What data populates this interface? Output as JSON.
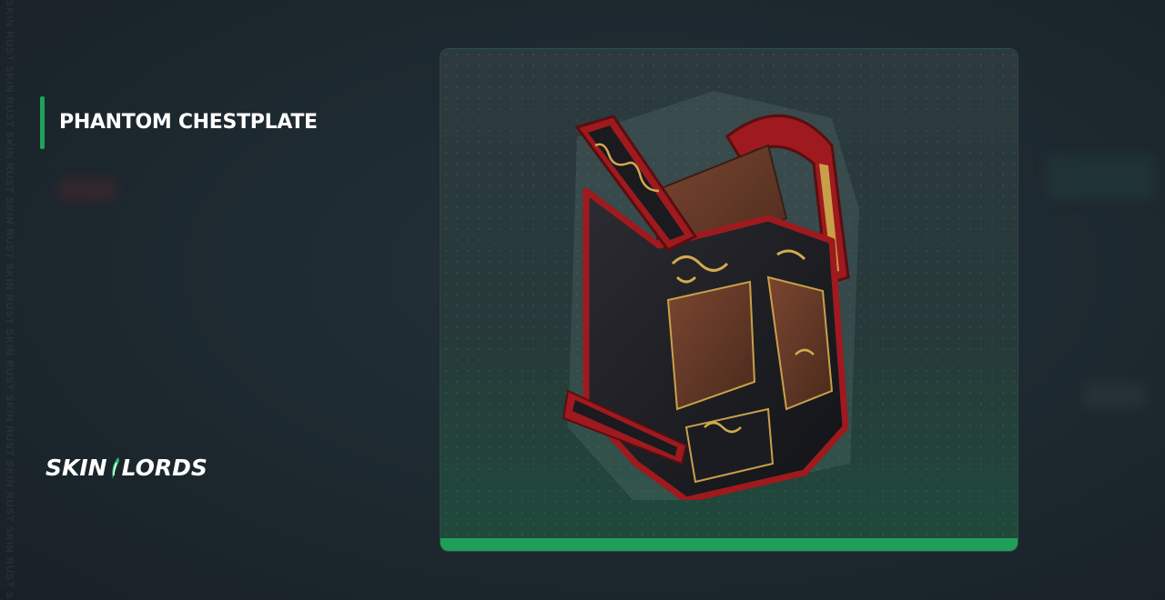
{
  "item": {
    "name": "PHANTOM CHESTPLATE"
  },
  "brand": {
    "logo_left": "SKIN",
    "logo_right": "LORDS",
    "watermark": "SKIN RUST SKIN RUST SKIN RUST SKIN RUST SKIN RUST SKIN RUST SKIN RUST SKIN RUST SKIN RUST SKIN RUST"
  },
  "colors": {
    "accent": "#1fa05a",
    "background": "#1e2a31",
    "card_bottom": "#1f4a3b"
  },
  "icons": {
    "logo_mark": "leaf-slash-icon",
    "item": "chestplate-armor-image"
  }
}
